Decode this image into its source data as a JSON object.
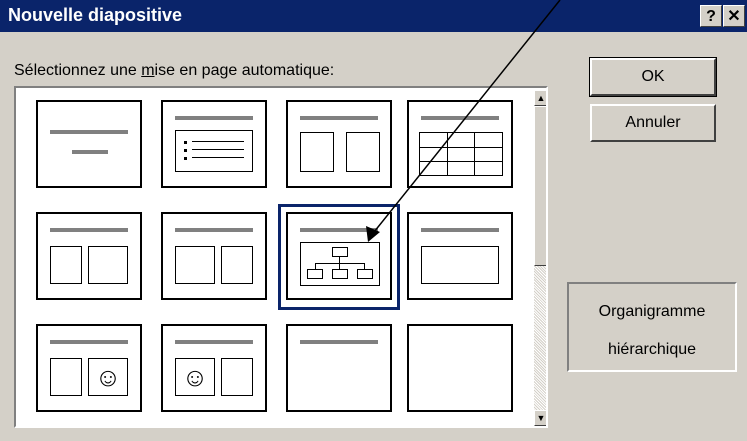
{
  "dialog": {
    "title": "Nouvelle diapositive",
    "help_btn": "?",
    "close_btn": "✕"
  },
  "label": {
    "pre": "Sélectionnez une ",
    "mnemonic": "m",
    "post": "ise en page automatique:"
  },
  "buttons": {
    "ok": "OK",
    "cancel": "Annuler"
  },
  "preview": {
    "line1": "Organigramme",
    "line2": "hiérarchique"
  },
  "layouts": [
    {
      "kind": "title"
    },
    {
      "kind": "bullets"
    },
    {
      "kind": "two-column"
    },
    {
      "kind": "table"
    },
    {
      "kind": "text-chart"
    },
    {
      "kind": "chart-text"
    },
    {
      "kind": "org-chart",
      "selected": true
    },
    {
      "kind": "chart"
    },
    {
      "kind": "text-clipart"
    },
    {
      "kind": "clipart-text"
    },
    {
      "kind": "title-only"
    },
    {
      "kind": "blank"
    }
  ],
  "scrollbar": {
    "up": "▲",
    "down": "▼"
  }
}
